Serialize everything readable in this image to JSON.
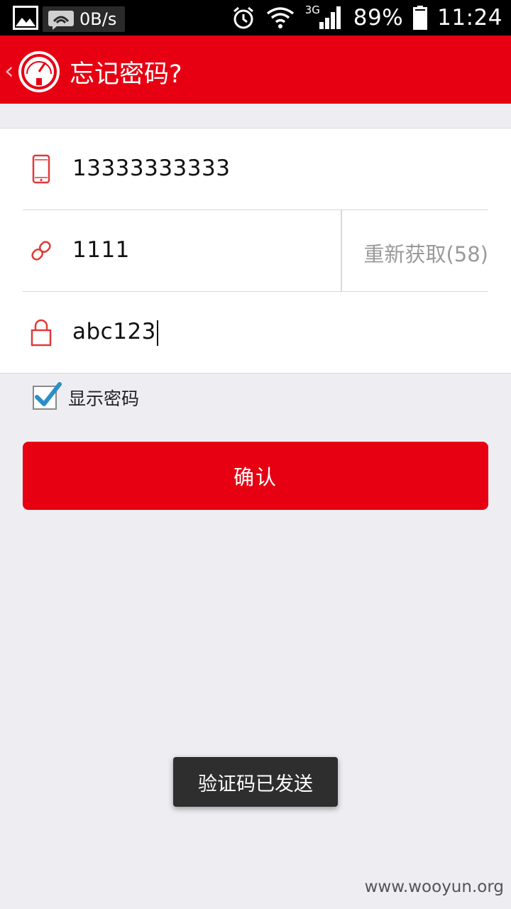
{
  "status_bar": {
    "net_speed": "0B/s",
    "network_type": "3G",
    "battery": "89%",
    "time": "11:24",
    "icons": [
      "image-icon",
      "wifi-sync-icon",
      "alarm-icon",
      "wifi-icon",
      "signal-icon",
      "battery-icon"
    ]
  },
  "app_bar": {
    "back": "‹",
    "title": "忘记密码?",
    "logo_icon": "fuel-gauge-icon",
    "color": "#e60012"
  },
  "form": {
    "phone": {
      "icon": "phone-icon",
      "value": "13333333333"
    },
    "code": {
      "icon": "link-icon",
      "value": "1111",
      "resend_label": "重新获取(58)"
    },
    "password": {
      "icon": "lock-icon",
      "value": "abc123"
    }
  },
  "show_password": {
    "label": "显示密码",
    "checked": true
  },
  "confirm_button": {
    "label": "确认"
  },
  "toast": {
    "message": "验证码已发送"
  },
  "watermark": "www.wooyun.org"
}
